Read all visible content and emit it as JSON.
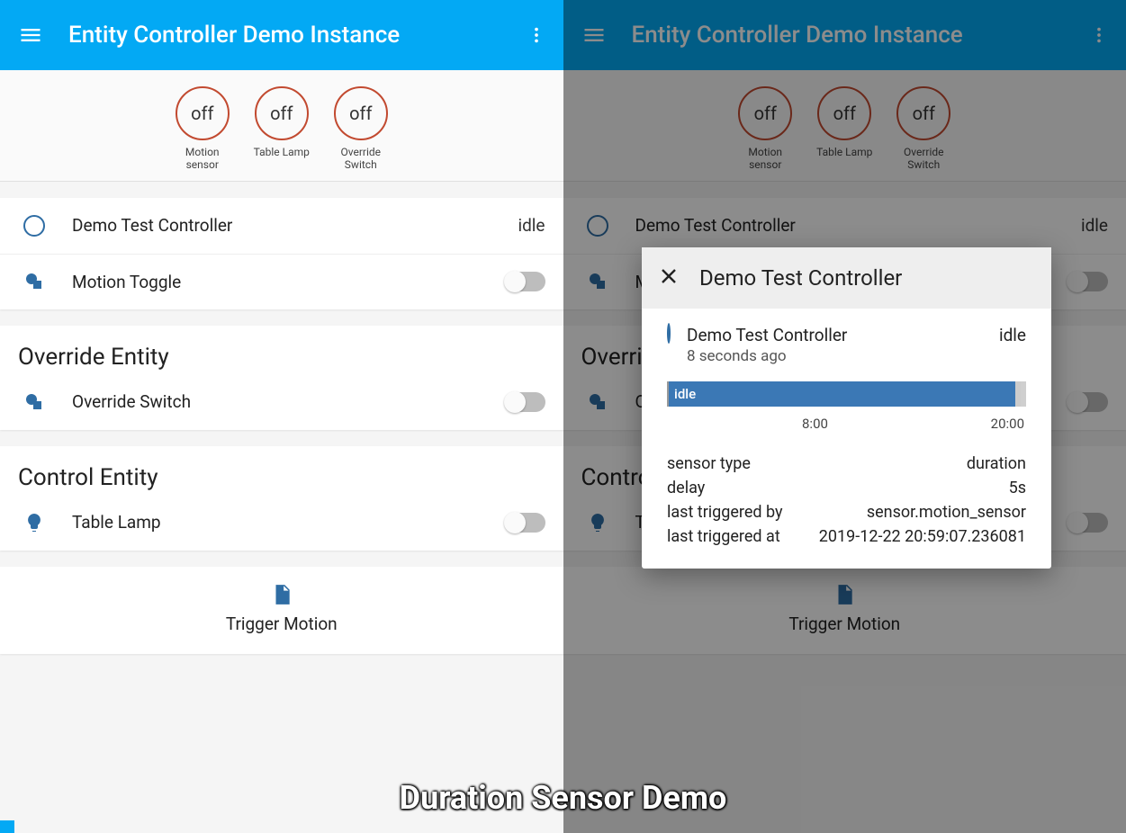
{
  "app": {
    "title": "Entity Controller Demo Instance"
  },
  "badges": [
    {
      "state": "off",
      "label": "Motion sensor"
    },
    {
      "state": "off",
      "label": "Table Lamp"
    },
    {
      "state": "off",
      "label": "Override Switch"
    }
  ],
  "main_card": {
    "rows": [
      {
        "name": "Demo Test Controller",
        "state": "idle"
      },
      {
        "name": "Motion Toggle"
      }
    ]
  },
  "override_card": {
    "title": "Override Entity",
    "row": {
      "name": "Override Switch"
    }
  },
  "control_card": {
    "title": "Control Entity",
    "row": {
      "name": "Table Lamp"
    }
  },
  "script_card": {
    "label": "Trigger Motion"
  },
  "dialog": {
    "title": "Demo Test Controller",
    "entity_name": "Demo Test Controller",
    "state": "idle",
    "last_changed": "8 seconds ago",
    "history_label": "idle",
    "axis": {
      "tick1": "8:00",
      "tick2": "20:00"
    },
    "attributes": [
      {
        "k": "sensor type",
        "v": "duration"
      },
      {
        "k": "delay",
        "v": "5s"
      },
      {
        "k": "last triggered by",
        "v": "sensor.motion_sensor"
      },
      {
        "k": "last triggered at",
        "v": "2019-12-22 20:59:07.236081"
      }
    ]
  },
  "caption": "Duration Sensor Demo"
}
